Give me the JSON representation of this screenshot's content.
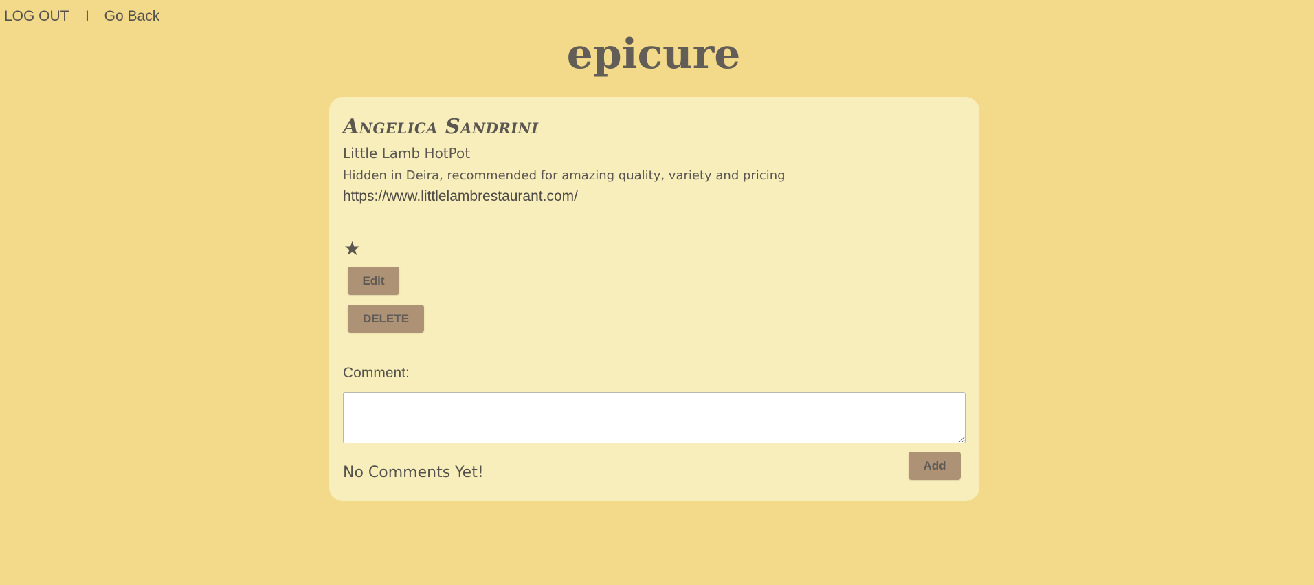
{
  "nav": {
    "logout_label": "LOG OUT",
    "separator": "I",
    "back_label": "Go Back"
  },
  "brand": "epicure",
  "post": {
    "author": "Angelica Sandrini",
    "restaurant": "Little Lamb HotPot",
    "description": "Hidden in Deira, recommended for amazing quality, variety and pricing",
    "url": "https://www.littlelambrestaurant.com/",
    "rating_stars": "★",
    "rating_value": 1
  },
  "actions": {
    "edit_label": "Edit",
    "delete_label": "DELETE"
  },
  "comments": {
    "label": "Comment:",
    "input_value": "",
    "add_label": "Add",
    "empty_text": "No Comments Yet!"
  },
  "colors": {
    "page_background": "#f3da8a",
    "card_background": "#f7eebb",
    "button_background": "#ad9276",
    "text": "#5e5a55"
  }
}
